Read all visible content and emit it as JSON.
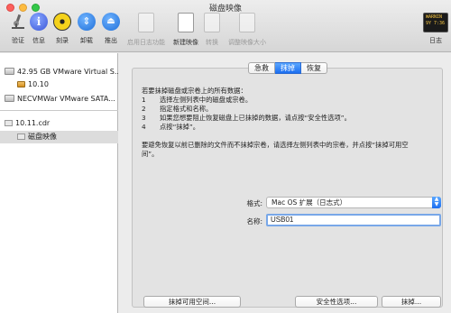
{
  "window": {
    "title": "磁盘映像"
  },
  "toolbar": {
    "verify": "验证",
    "info": "信息",
    "burn": "刻录",
    "unmount": "卸载",
    "eject": "推出",
    "enable_journaling": "启用日志功能",
    "new_image": "新建映像",
    "convert": "转换",
    "resize_image": "调整映像大小",
    "log": "日志",
    "log_icon_text": "WARNIN\n9Y 7:36"
  },
  "sidebar": {
    "items": [
      {
        "label": "42.95 GB VMware Virtual S..."
      },
      {
        "label": "10.10"
      },
      {
        "label": "NECVMWar VMware SATA..."
      },
      {
        "label": "10.11.cdr"
      },
      {
        "label": "磁盘映像"
      }
    ]
  },
  "tabs": [
    {
      "label": "急救"
    },
    {
      "label": "抹掉"
    },
    {
      "label": "恢复"
    }
  ],
  "erase": {
    "intro": "若要抹掉磁盘或宗卷上的所有数据：",
    "steps": [
      {
        "num": "1",
        "text": "选择左侧列表中的磁盘或宗卷。"
      },
      {
        "num": "2",
        "text": "指定格式和名称。"
      },
      {
        "num": "3",
        "text": "如果您想要阻止恢复磁盘上已抹掉的数据，请点按“安全性选项”。"
      },
      {
        "num": "4",
        "text": "点按“抹掉”。"
      }
    ],
    "note": "要避免恢复以前已删除的文件而不抹掉宗卷，请选择左侧列表中的宗卷，并点按“抹掉可用空间”。",
    "format_label": "格式:",
    "format_value": "Mac OS 扩展（日志式）",
    "name_label": "名称:",
    "name_value": "USB01",
    "erase_free_space": "抹掉可用空间...",
    "security_options": "安全性选项...",
    "erase_button": "抹掉..."
  }
}
